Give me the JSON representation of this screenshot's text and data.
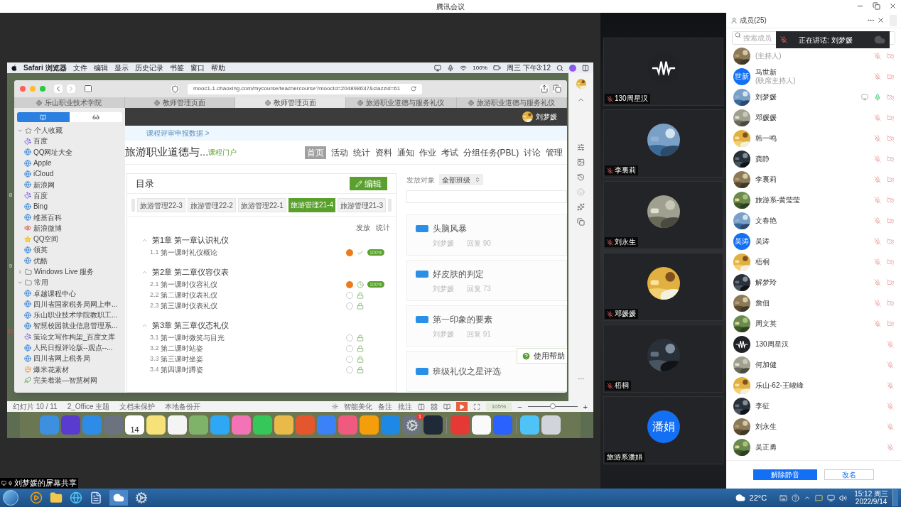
{
  "window": {
    "title": "腾讯会议"
  },
  "shared_screen": {
    "owner_label": "刘梦媛的屏幕共享",
    "menubar": {
      "items": [
        "Safari 浏览器",
        "文件",
        "编辑",
        "显示",
        "历史记录",
        "书签",
        "窗口",
        "帮助"
      ],
      "battery": "100%",
      "clock": "周三 下午3:12"
    },
    "slide_numbers": [
      "8",
      "9",
      "10"
    ],
    "safari": {
      "url": "mooc1-1.chaoxing.com/mycourse/teachercourse?moocId=204898637&clazzid=61",
      "tabs": [
        {
          "title": "乐山职业技术学院",
          "selected": false
        },
        {
          "title": "教师管理页面",
          "selected": false
        },
        {
          "title": "教师管理页面",
          "selected": true
        },
        {
          "title": "旅游职业道德与服务礼仪",
          "selected": false
        },
        {
          "title": "旅游职业道德与服务礼仪",
          "selected": false
        }
      ],
      "segments": [
        {
          "kind": "bookmarks",
          "selected": true
        },
        {
          "kind": "reading_list",
          "selected": false
        }
      ],
      "bookmarks": [
        {
          "label": "个人收藏",
          "kind": "favorites",
          "expanded": true,
          "children": [
            {
              "label": "百度",
              "kind": "paw"
            },
            {
              "label": "QQ网址大全",
              "kind": "globe"
            },
            {
              "label": "Apple",
              "kind": "globe"
            },
            {
              "label": "iCloud",
              "kind": "globe"
            },
            {
              "label": "新浪网",
              "kind": "globe"
            },
            {
              "label": "百度",
              "kind": "paw"
            },
            {
              "label": "Bing",
              "kind": "globe"
            },
            {
              "label": "维基百科",
              "kind": "globe"
            },
            {
              "label": "新浪微博",
              "kind": "eye"
            },
            {
              "label": "QQ空间",
              "kind": "star"
            },
            {
              "label": "领英",
              "kind": "globe"
            },
            {
              "label": "优酷",
              "kind": "globe"
            }
          ]
        },
        {
          "label": "Windows Live 服务",
          "kind": "folder",
          "expanded": false
        },
        {
          "label": "常用",
          "kind": "folder",
          "expanded": true,
          "children": [
            {
              "label": "卓越课程中心",
              "kind": "globe"
            },
            {
              "label": "四川省国家税务局网上申...",
              "kind": "globe"
            },
            {
              "label": "乐山职业技术学院教职工...",
              "kind": "globe"
            },
            {
              "label": "智慧校园就业信息管理系...",
              "kind": "globe"
            },
            {
              "label": "策论文写作构架_百度文库",
              "kind": "paw"
            },
            {
              "label": "人民日报评论版--观点--...",
              "kind": "globe"
            },
            {
              "label": "四川省网上税务局",
              "kind": "globe"
            },
            {
              "label": "爆米花素材",
              "kind": "bowl"
            },
            {
              "label": "完美着装—智慧树网",
              "kind": "leaf"
            }
          ]
        }
      ],
      "page": {
        "user": "刘梦媛",
        "breadcrumb": "课程评审申报数据 >",
        "course_title": "旅游职业道德与...",
        "portal_link": "课程门户",
        "nav": [
          {
            "label": "首页",
            "selected": true
          },
          {
            "label": "活动",
            "selected": false
          },
          {
            "label": "统计",
            "selected": false
          },
          {
            "label": "资料",
            "selected": false
          },
          {
            "label": "通知",
            "selected": false
          },
          {
            "label": "作业",
            "selected": false
          },
          {
            "label": "考试",
            "selected": false
          },
          {
            "label": "分组任务(PBL)",
            "selected": false
          },
          {
            "label": "讨论",
            "selected": false
          },
          {
            "label": "管理",
            "selected": false
          }
        ],
        "catalog": {
          "title": "目录",
          "edit_button": "编辑",
          "class_tabs": [
            {
              "label": "旅游管理22-3",
              "selected": false
            },
            {
              "label": "旅游管理22-2",
              "selected": false
            },
            {
              "label": "旅游管理22-1",
              "selected": false
            },
            {
              "label": "旅游管理21-4",
              "selected": true
            },
            {
              "label": "旅游管理21-3",
              "selected": false
            }
          ],
          "columns": [
            "发放",
            "统计"
          ],
          "chapters": [
            {
              "title": "第1章 第一章认识礼仪",
              "expanded": true,
              "lessons": [
                {
                  "number": "1.1",
                  "title": "第一课时礼仪概论",
                  "kind": "done",
                  "stat": "100%"
                }
              ]
            },
            {
              "title": "第2章 第二章仪容仪表",
              "expanded": true,
              "lessons": [
                {
                  "number": "2.1",
                  "title": "第一课时仪容礼仪",
                  "kind": "timed",
                  "stat": "100%"
                },
                {
                  "number": "2.2",
                  "title": "第二课时仪表礼仪",
                  "kind": "locked"
                },
                {
                  "number": "2.3",
                  "title": "第三课时仪表礼仪",
                  "kind": "locked"
                }
              ]
            },
            {
              "title": "第3章 第三章仪态礼仪",
              "expanded": true,
              "lessons": [
                {
                  "number": "3.1",
                  "title": "第一课时微笑与目光",
                  "kind": "locked"
                },
                {
                  "number": "3.2",
                  "title": "第二课时站姿",
                  "kind": "locked"
                },
                {
                  "number": "3.3",
                  "title": "第三课时坐姿",
                  "kind": "locked"
                },
                {
                  "number": "3.4",
                  "title": "第四课时蹲姿",
                  "kind": "locked"
                }
              ]
            }
          ]
        },
        "target_label": "发放对象",
        "target_select": "全部班级",
        "activities": [
          {
            "title": "头脑风暴",
            "author": "刘梦媛",
            "replies": "回复 90"
          },
          {
            "title": "好皮肤的判定",
            "author": "刘梦媛",
            "replies": "回复 73"
          },
          {
            "title": "第一印象的要素",
            "author": "刘梦媛",
            "replies": "回复 91"
          },
          {
            "title": "班级礼仪之星评选"
          }
        ],
        "help_button": "使用帮助"
      }
    },
    "statusbar": {
      "left": [
        "幻灯片 10 / 11",
        "2_Office 主题",
        "文档未保护",
        "本地备份开"
      ],
      "beautify": "智能美化",
      "notes": "备注",
      "comments": "批注",
      "zoom": "105%",
      "minus": "−",
      "plus": "+",
      "zoom_slider": {
        "level": 0.5
      }
    },
    "dock": {
      "calendar_date": "14",
      "settings_badge": "1"
    }
  },
  "videos": [
    {
      "name": "130周星汉",
      "avatar": {
        "kind": "waveform"
      },
      "mic_icon": true
    },
    {
      "name": "李裏莉",
      "mic_icon": true
    },
    {
      "name": "刘永生",
      "mic_icon": true
    },
    {
      "name": "邓媛媛",
      "mic_icon": true
    },
    {
      "name": "梧桐",
      "mic_icon": true
    },
    {
      "name": "旅游系潘娟",
      "avatar": {
        "kind": "initials",
        "text": "潘娟"
      },
      "mic_icon": false
    }
  ],
  "members_panel": {
    "title": "成员(25)",
    "search_placeholder": "搜索成员",
    "speaking": "正在讲话: 刘梦媛",
    "members": [
      {
        "role": "(主持人)",
        "mic_on": false,
        "cam_off": true,
        "sharing": false
      },
      {
        "name": "马世新",
        "role": "(联席主持人)",
        "avatar": {
          "kind": "initials",
          "text": "世新"
        },
        "mic_on": false,
        "cam_off": true,
        "sharing": false
      },
      {
        "name": "刘梦媛",
        "mic_on": true,
        "cam_off": true,
        "sharing": true
      },
      {
        "name": "邓媛媛",
        "mic_on": false,
        "cam_off": true,
        "sharing": false
      },
      {
        "name": "韩一鸣",
        "mic_on": false,
        "cam_off": true,
        "sharing": false
      },
      {
        "name": "龚静",
        "mic_on": false,
        "cam_off": true,
        "sharing": false
      },
      {
        "name": "李裏莉",
        "mic_on": false,
        "cam_off": true,
        "sharing": false
      },
      {
        "name": "旅游系-黄莹莹",
        "mic_on": false,
        "cam_off": true,
        "sharing": false
      },
      {
        "name": "文春艳",
        "mic_on": false,
        "cam_off": true,
        "sharing": false
      },
      {
        "name": "吴涛",
        "avatar": {
          "kind": "initials",
          "text": "吴涛"
        },
        "mic_on": false,
        "cam_off": true,
        "sharing": false
      },
      {
        "name": "梧桐",
        "mic_on": false,
        "cam_off": true,
        "sharing": false
      },
      {
        "name": "解梦玲",
        "mic_on": false,
        "cam_off": true,
        "sharing": false
      },
      {
        "name": "詹佃",
        "mic_on": false,
        "cam_off": true,
        "sharing": false
      },
      {
        "name": "周文英",
        "mic_on": false,
        "cam_off": true,
        "sharing": false
      },
      {
        "name": "130周星汉",
        "avatar": {
          "kind": "waveform"
        },
        "mic_on": false,
        "cam_off": false,
        "sharing": false
      },
      {
        "name": "何加健",
        "mic_on": false,
        "cam_off": false,
        "sharing": false
      },
      {
        "name": "乐山-62-王峻峰",
        "mic_on": false,
        "cam_off": false,
        "sharing": false
      },
      {
        "name": "李征",
        "mic_on": false,
        "cam_off": false,
        "sharing": false
      },
      {
        "name": "刘永生",
        "mic_on": false,
        "cam_off": false,
        "sharing": false
      },
      {
        "name": "吴正勇",
        "mic_on": false,
        "cam_off": false,
        "sharing": false
      }
    ],
    "buttons": [
      {
        "label": "解除静音",
        "kind": "primary"
      },
      {
        "label": "改名",
        "kind": "secondary"
      }
    ]
  },
  "taskbar": {
    "temperature": "22°C",
    "time": "15:12 周三",
    "date": "2022/9/14"
  }
}
